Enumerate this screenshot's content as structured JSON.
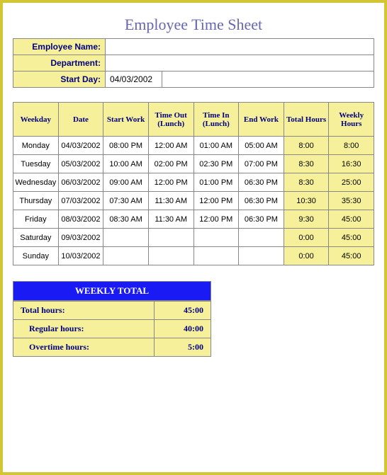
{
  "title": "Employee Time Sheet",
  "info_labels": {
    "employee_name": "Employee Name:",
    "department": "Department:",
    "start_day": "Start Day:"
  },
  "info_values": {
    "employee_name": "",
    "department": "",
    "start_day": "04/03/2002"
  },
  "headers": {
    "weekday": "Weekday",
    "date": "Date",
    "start_work": "Start Work",
    "time_out": "Time Out (Lunch)",
    "time_in": "Time In (Lunch)",
    "end_work": "End Work",
    "total_hours": "Total Hours",
    "weekly_hours": "Weekly Hours"
  },
  "rows": [
    {
      "weekday": "Monday",
      "date": "04/03/2002",
      "start": "08:00 PM",
      "out": "12:00 AM",
      "in": "01:00 AM",
      "end": "05:00 AM",
      "total": "8:00",
      "weekly": "8:00"
    },
    {
      "weekday": "Tuesday",
      "date": "05/03/2002",
      "start": "10:00 AM",
      "out": "02:00 PM",
      "in": "02:30 PM",
      "end": "07:00 PM",
      "total": "8:30",
      "weekly": "16:30"
    },
    {
      "weekday": "Wednesday",
      "date": "06/03/2002",
      "start": "09:00 AM",
      "out": "12:00 PM",
      "in": "01:00 PM",
      "end": "06:30 PM",
      "total": "8:30",
      "weekly": "25:00"
    },
    {
      "weekday": "Thursday",
      "date": "07/03/2002",
      "start": "07:30 AM",
      "out": "11:30 AM",
      "in": "12:00 PM",
      "end": "06:30 PM",
      "total": "10:30",
      "weekly": "35:30"
    },
    {
      "weekday": "Friday",
      "date": "08/03/2002",
      "start": "08:30 AM",
      "out": "11:30 AM",
      "in": "12:00 PM",
      "end": "06:30 PM",
      "total": "9:30",
      "weekly": "45:00"
    },
    {
      "weekday": "Saturday",
      "date": "09/03/2002",
      "start": "",
      "out": "",
      "in": "",
      "end": "",
      "total": "0:00",
      "weekly": "45:00"
    },
    {
      "weekday": "Sunday",
      "date": "10/03/2002",
      "start": "",
      "out": "",
      "in": "",
      "end": "",
      "total": "0:00",
      "weekly": "45:00"
    }
  ],
  "summary": {
    "header": "WEEKLY TOTAL",
    "total_label": "Total hours:",
    "total_val": "45:00",
    "regular_label": "Regular hours:",
    "regular_val": "40:00",
    "overtime_label": "Overtime hours:",
    "overtime_val": "5:00"
  },
  "chart_data": {
    "type": "table",
    "title": "Employee Time Sheet",
    "columns": [
      "Weekday",
      "Date",
      "Start Work",
      "Time Out (Lunch)",
      "Time In (Lunch)",
      "End Work",
      "Total Hours",
      "Weekly Hours"
    ],
    "data": [
      [
        "Monday",
        "04/03/2002",
        "08:00 PM",
        "12:00 AM",
        "01:00 AM",
        "05:00 AM",
        "8:00",
        "8:00"
      ],
      [
        "Tuesday",
        "05/03/2002",
        "10:00 AM",
        "02:00 PM",
        "02:30 PM",
        "07:00 PM",
        "8:30",
        "16:30"
      ],
      [
        "Wednesday",
        "06/03/2002",
        "09:00 AM",
        "12:00 PM",
        "01:00 PM",
        "06:30 PM",
        "8:30",
        "25:00"
      ],
      [
        "Thursday",
        "07/03/2002",
        "07:30 AM",
        "11:30 AM",
        "12:00 PM",
        "06:30 PM",
        "10:30",
        "35:30"
      ],
      [
        "Friday",
        "08/03/2002",
        "08:30 AM",
        "11:30 AM",
        "12:00 PM",
        "06:30 PM",
        "9:30",
        "45:00"
      ],
      [
        "Saturday",
        "09/03/2002",
        "",
        "",
        "",
        "",
        "0:00",
        "45:00"
      ],
      [
        "Sunday",
        "10/03/2002",
        "",
        "",
        "",
        "",
        "0:00",
        "45:00"
      ]
    ],
    "summary": {
      "Total hours": "45:00",
      "Regular hours": "40:00",
      "Overtime hours": "5:00"
    }
  }
}
